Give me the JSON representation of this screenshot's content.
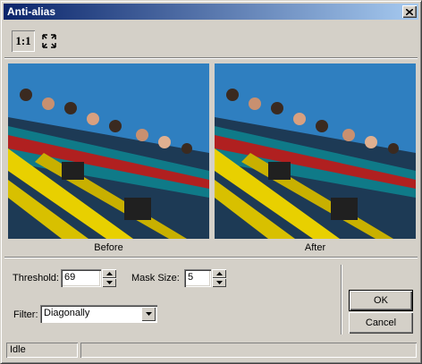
{
  "window": {
    "title": "Anti-alias",
    "close_glyph": "✕"
  },
  "toolbar": {
    "actual_size_label": "1:1",
    "fit_icon": "fit-to-window-icon"
  },
  "preview": {
    "before_label": "Before",
    "after_label": "After"
  },
  "params": {
    "threshold_label": "Threshold:",
    "threshold_value": "69",
    "mask_size_label": "Mask Size:",
    "mask_size_value": "5",
    "filter_label": "Filter:",
    "filter_value": "Diagonally"
  },
  "buttons": {
    "ok": "OK",
    "cancel": "Cancel"
  },
  "status": {
    "text": "Idle",
    "secondary": ""
  },
  "colors": {
    "title_start": "#0a246a",
    "title_end": "#a6caf0",
    "sky": "#2f7fc0",
    "face": "#d4d0c8"
  }
}
